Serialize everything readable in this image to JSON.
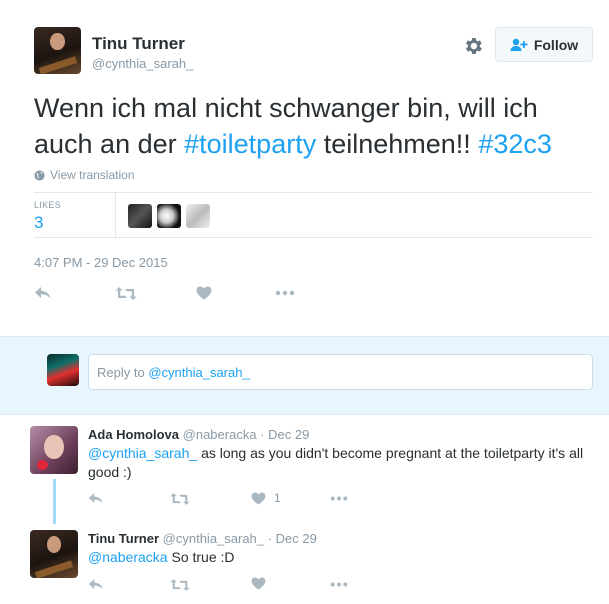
{
  "tweet": {
    "author_name": "Tinu Turner",
    "author_handle": "@cynthia_sarah_",
    "text_part1": "Wenn ich mal nicht schwanger bin, will ich",
    "text_part2": "auch an der",
    "hashtag1": "#toiletparty",
    "text_part3": "teilnehmen!!",
    "hashtag2": "#32c3",
    "view_translation": "View translation",
    "likes_label": "LIKES",
    "likes_count": "3",
    "timestamp": "4:07 PM - 29 Dec 2015",
    "follow_label": "Follow"
  },
  "reply_box": {
    "prefix": "Reply to",
    "mention": "@cynthia_sarah_"
  },
  "replies": [
    {
      "name": "Ada Homolova",
      "handle": "@naberacka",
      "sep": "·",
      "date": "Dec 29",
      "mention": "@cynthia_sarah_",
      "text_line1": "as long as you didn't become pregnant at the toiletparty it's all",
      "text_line2": "good :)",
      "like_count": "1"
    },
    {
      "name": "Tinu Turner",
      "handle": "@cynthia_sarah_",
      "sep": "·",
      "date": "Dec 29",
      "mention": "@naberacka",
      "text": "So true :D"
    }
  ],
  "colors": {
    "link": "#1da1f2",
    "muted": "#8899a6",
    "reply_bg": "#e8f5fd"
  },
  "icons": [
    "gear-icon",
    "follow-person-icon",
    "globe-icon",
    "reply-icon",
    "retweet-icon",
    "heart-icon",
    "more-icon"
  ]
}
